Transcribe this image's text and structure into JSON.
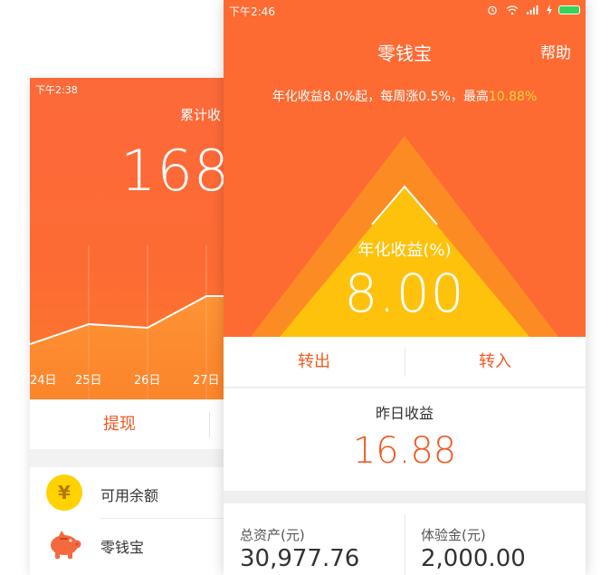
{
  "back_screen": {
    "status_time": "下午2:38",
    "title": "累计收",
    "amount": "168",
    "chart_dates": [
      "24日",
      "25日",
      "26日",
      "27日"
    ],
    "withdraw_label": "提现",
    "list_items": [
      {
        "label": "可用余额",
        "icon": "yen-coin-icon"
      },
      {
        "label": "零钱宝",
        "icon": "piggy-bank-icon"
      }
    ],
    "yen_symbol": "¥"
  },
  "front_screen": {
    "status_time": "下午2:46",
    "title": "零钱宝",
    "help_label": "帮助",
    "rate_text": "年化收益8.0%起，每周涨0.5%，最高",
    "rate_highlight": "10.88%",
    "yield_label": "年化收益(%)",
    "yield_value": "8.00",
    "transfer_out_label": "转出",
    "transfer_in_label": "转入",
    "yesterday_label": "昨日收益",
    "yesterday_value": "16.88",
    "total_assets_label": "总资产(元)",
    "total_assets_value": "30,977.76",
    "trial_fund_label": "体验金(元)",
    "trial_fund_value": "2,000.00"
  },
  "colors": {
    "brand_orange": "#fd6b33",
    "accent_text": "#f15a22",
    "highlight_yellow": "#ffd43b",
    "mountain_outer": "#fd8b24",
    "mountain_inner": "#ffc107"
  }
}
